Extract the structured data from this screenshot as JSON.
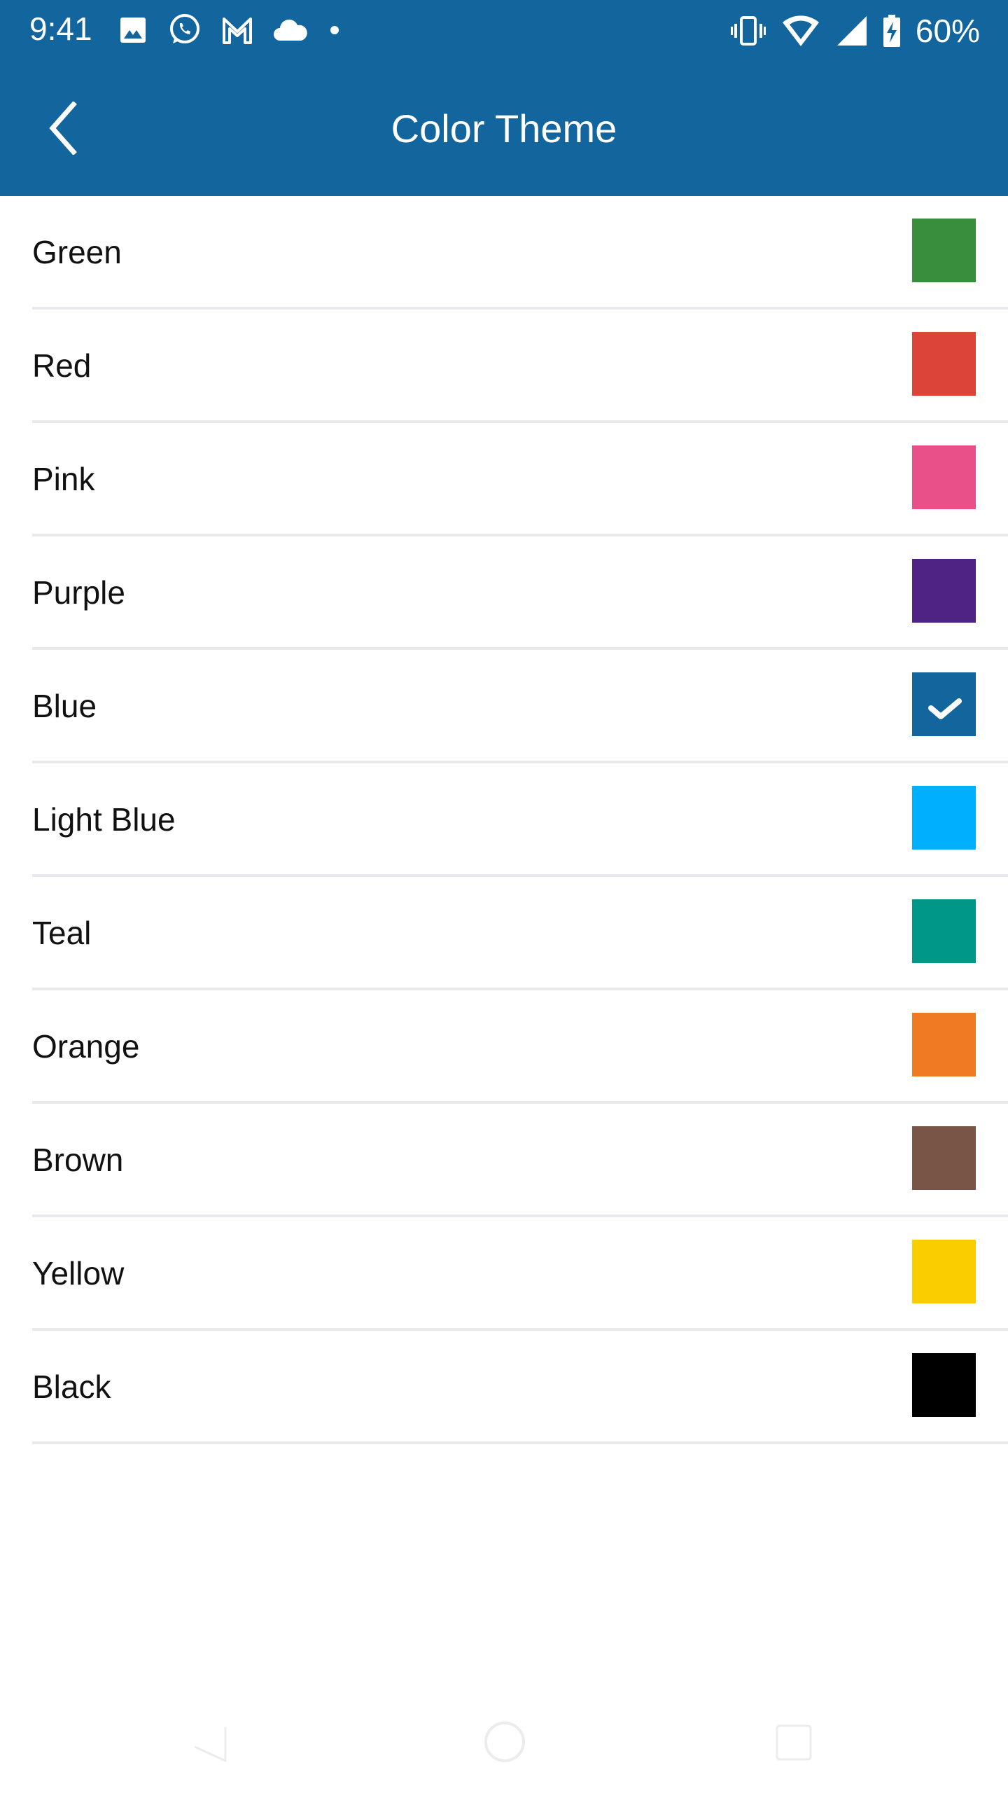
{
  "status_bar": {
    "time": "9:41",
    "left_icons": [
      "gallery-icon",
      "whatsapp-icon",
      "gmail-icon",
      "cloud-icon",
      "dot-icon"
    ],
    "right_icons": [
      "vibrate-icon",
      "wifi-icon",
      "signal-icon",
      "battery-charging-icon"
    ],
    "battery_percent": "60%"
  },
  "app_bar": {
    "title": "Color Theme",
    "back_icon": "chevron-left-icon",
    "background": "#13659d"
  },
  "themes": [
    {
      "name": "Green",
      "color": "#388e3c",
      "selected": false
    },
    {
      "name": "Red",
      "color": "#dc4437",
      "selected": false
    },
    {
      "name": "Pink",
      "color": "#e94f89",
      "selected": false
    },
    {
      "name": "Purple",
      "color": "#4e2384",
      "selected": false
    },
    {
      "name": "Blue",
      "color": "#13659d",
      "selected": true
    },
    {
      "name": "Light Blue",
      "color": "#00b0ff",
      "selected": false
    },
    {
      "name": "Teal",
      "color": "#009688",
      "selected": false
    },
    {
      "name": "Orange",
      "color": "#f07a24",
      "selected": false
    },
    {
      "name": "Brown",
      "color": "#795548",
      "selected": false
    },
    {
      "name": "Yellow",
      "color": "#f9cd00",
      "selected": false
    },
    {
      "name": "Black",
      "color": "#000000",
      "selected": false
    }
  ],
  "nav_bar": {
    "buttons": [
      "back-nav-icon",
      "home-nav-icon",
      "recents-nav-icon"
    ]
  }
}
